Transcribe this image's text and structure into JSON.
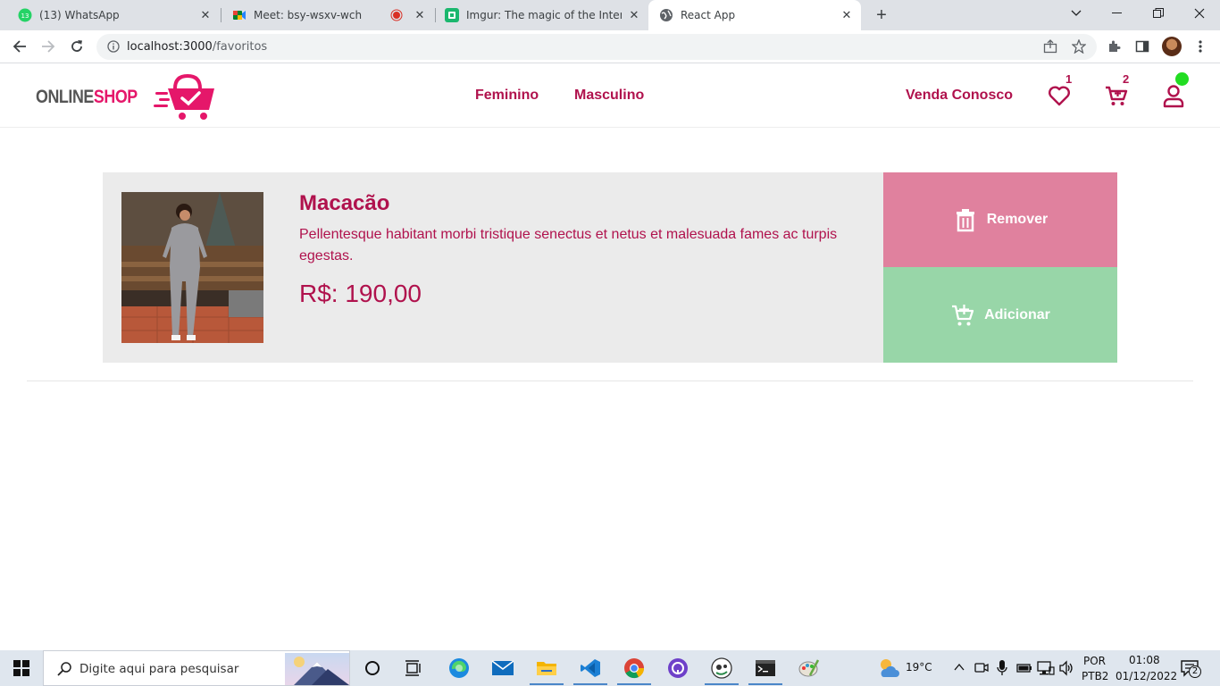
{
  "browser": {
    "tabs": [
      {
        "title": "(13) WhatsApp",
        "favicon": "whatsapp-icon",
        "badge": "13"
      },
      {
        "title": "Meet: bsy-wsxv-wch",
        "favicon": "meet-icon"
      },
      {
        "title": "Imgur: The magic of the Internet",
        "favicon": "imgur-icon"
      },
      {
        "title": "React App",
        "favicon": "globe-icon",
        "active": true
      }
    ],
    "url_host": "localhost:3000",
    "url_path": "/favoritos"
  },
  "site": {
    "logo_part1": "ONLINE",
    "logo_part2": "SHOP",
    "nav": [
      "Feminino",
      "Masculino"
    ],
    "sell_link": "Venda Conosco",
    "favorites_count": "1",
    "cart_count": "2",
    "colors": {
      "brand": "#b0124d",
      "logo_accent": "#e5176a",
      "remove": "#e0819e",
      "add": "#98d6a8",
      "online": "#22dd22"
    }
  },
  "favorites": [
    {
      "name": "Macacão",
      "description": "Pellentesque habitant morbi tristique senectus et netus et malesuada fames ac turpis egestas.",
      "price": "R$: 190,00",
      "remove_label": "Remover",
      "add_label": "Adicionar"
    }
  ],
  "taskbar": {
    "search_placeholder": "Digite aqui para pesquisar",
    "weather": "19°C",
    "lang_top": "POR",
    "lang_bottom": "PTB2",
    "time": "01:08",
    "date": "01/12/2022",
    "notifications": "2"
  }
}
